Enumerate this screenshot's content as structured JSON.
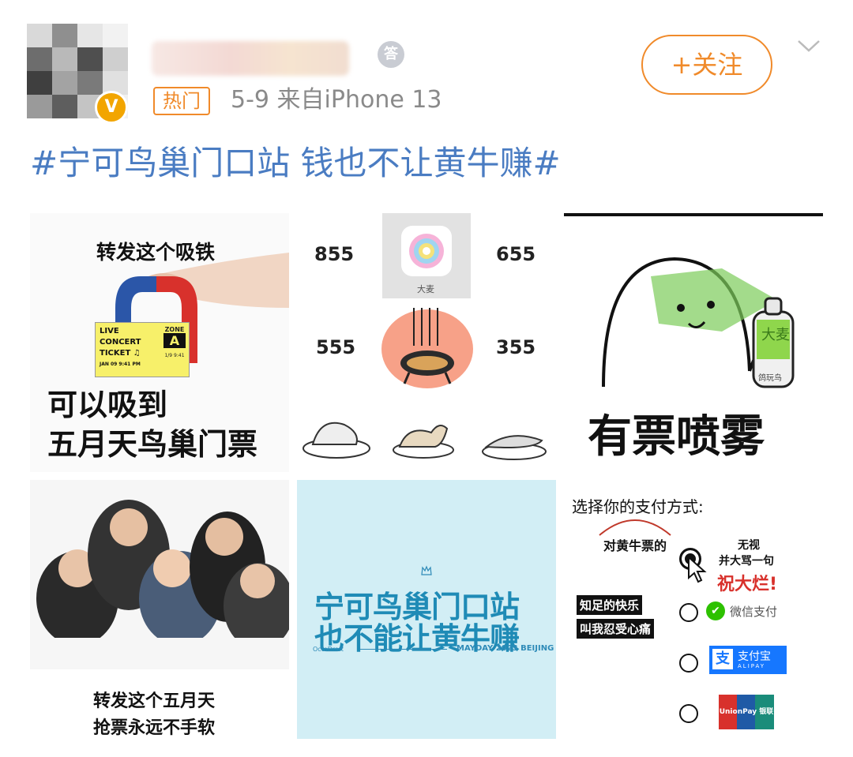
{
  "post": {
    "hot_badge": "热门",
    "date_source": "5-9  来自iPhone 13",
    "follow_label": "+关注",
    "topic": "#宁可鸟巢门口站 钱也不让黄牛赚#",
    "medal_text": "答",
    "verified_mark": "V"
  },
  "grid": {
    "c1": {
      "top": "转发这个吸铁",
      "ticket": [
        "LIVE",
        "CONCERT",
        "TICKET ♫",
        "JAN 09  9:41 PM"
      ],
      "zone": "ZONE",
      "zone_letter": "A",
      "ticket_side": "1/9  9:41",
      "bottom1": "可以吸到",
      "bottom2": "五月天鸟巢门票"
    },
    "c2": {
      "n1": "855",
      "n2": "655",
      "n3": "555",
      "n4": "355",
      "app_label": "大麦"
    },
    "c3": {
      "bottle_label": "大麦",
      "bottle_sub": "鸽玩鸟",
      "caption": "有票喷雾"
    },
    "c4": {
      "cap1": "转发这个五月天",
      "cap2": "抢票永远不手软"
    },
    "c5": {
      "line1": "宁可鸟巢门口站",
      "line2": "也不能让黄牛赚",
      "brand": "OctoDraft",
      "footer": "MAYDAY 2023 BEIJING"
    },
    "c6": {
      "title": "选择你的支付方式:",
      "sub": "对黄牛票的",
      "opt1_a": "无视",
      "opt1_b": "并大骂一句",
      "opt1_c": "祝大烂!",
      "side1": "知足的快乐",
      "side2": "叫我忍受心痛",
      "opt2": "微信支付",
      "opt3": "支付宝",
      "opt3_sub": "ALIPAY",
      "opt4": "UnionPay 银联"
    }
  },
  "colors": {
    "accent": "#f08a2a",
    "topic": "#4a7cc2",
    "meta": "#8a8a8a"
  }
}
